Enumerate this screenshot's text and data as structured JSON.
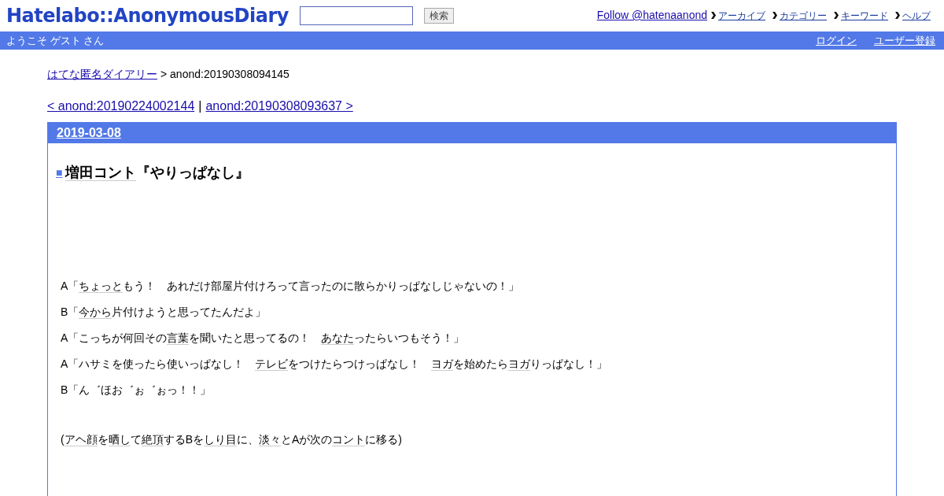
{
  "header": {
    "logo": "Hatelabo::AnonymousDiary",
    "search_button": "検索",
    "follow": "Follow @hatenaanond",
    "nav": [
      "アーカイブ",
      "カテゴリー",
      "キーワード",
      "ヘルプ"
    ]
  },
  "userbar": {
    "welcome": "ようこそ ゲスト さん",
    "links": [
      "ログイン",
      "ユーザー登録"
    ]
  },
  "breadcrumb": {
    "link": "はてな匿名ダイアリー",
    "current": "> anond:20190308094145"
  },
  "pager": {
    "prev": "< anond:20190224002144",
    "separator": "|",
    "next": "anond:20190308093637 >"
  },
  "day": {
    "date": "2019-03-08",
    "title_mark": "■",
    "title": [
      {
        "text": "増田コント",
        "keyword": true
      },
      {
        "text": "『やりっぱなし』",
        "keyword": false
      }
    ],
    "paragraphs": [
      [
        {
          "text": "A「",
          "keyword": false
        },
        {
          "text": "ちょっと",
          "keyword": true
        },
        {
          "text": "もう！　あれだけ部屋片付けろって言ったのに散らかりっぱなしじゃないの！」",
          "keyword": false
        }
      ],
      [
        {
          "text": "B「",
          "keyword": false
        },
        {
          "text": "今から",
          "keyword": true
        },
        {
          "text": "片付けようと思ってたんだよ」",
          "keyword": false
        }
      ],
      [
        {
          "text": "A「こっちが何回その",
          "keyword": false
        },
        {
          "text": "言葉",
          "keyword": true
        },
        {
          "text": "を聞いたと思ってるの！　",
          "keyword": false
        },
        {
          "text": "あなた",
          "keyword": true
        },
        {
          "text": "ったらいつもそう！」",
          "keyword": false
        }
      ],
      [
        {
          "text": "A「ハサミを使ったら使いっぱなし！　",
          "keyword": false
        },
        {
          "text": "テレビ",
          "keyword": true
        },
        {
          "text": "をつけたらつけっぱなし！　",
          "keyword": false
        },
        {
          "text": "ヨガ",
          "keyword": true
        },
        {
          "text": "を始めたら",
          "keyword": false
        },
        {
          "text": "ヨガ",
          "keyword": true
        },
        {
          "text": "りっぱなし！」",
          "keyword": false
        }
      ],
      [
        {
          "text": "B「ん゛ほお゛ぉ゛ぉっ！！」",
          "keyword": false
        }
      ],
      [
        {
          "text": "(",
          "keyword": false
        },
        {
          "text": "アヘ顔",
          "keyword": true
        },
        {
          "text": "を",
          "keyword": false
        },
        {
          "text": "晒し",
          "keyword": true
        },
        {
          "text": "て",
          "keyword": false
        },
        {
          "text": "絶頂",
          "keyword": true
        },
        {
          "text": "するBを",
          "keyword": false
        },
        {
          "text": "しり目",
          "keyword": true
        },
        {
          "text": "に、",
          "keyword": false
        },
        {
          "text": "淡々",
          "keyword": true
        },
        {
          "text": "とAが次の",
          "keyword": false
        },
        {
          "text": "コント",
          "keyword": true
        },
        {
          "text": "に移る)",
          "keyword": false
        }
      ]
    ]
  }
}
